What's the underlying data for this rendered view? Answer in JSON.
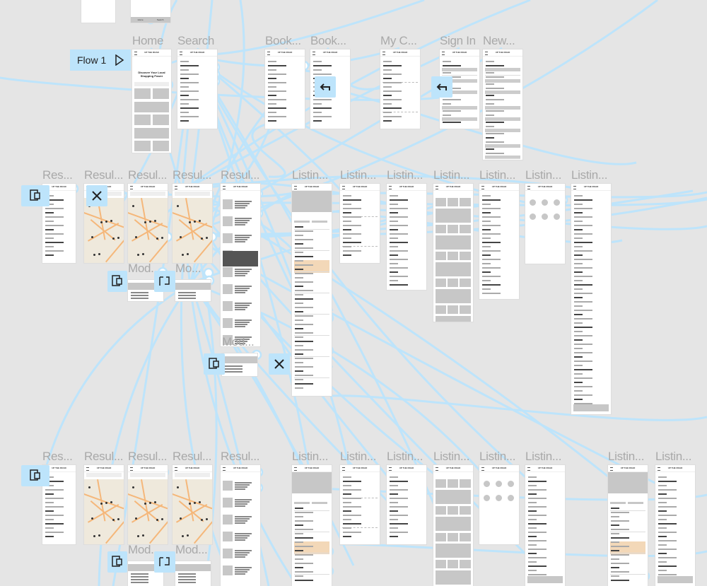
{
  "canvas": {
    "background": "#e5e5e5",
    "wire_color": "#bde4fb"
  },
  "flow": {
    "label": "Flow 1",
    "icon": "play-icon"
  },
  "app_header": "UP THE ROAD",
  "home": {
    "headline": "Discover Your Local Shopping Power",
    "nav": [
      "Home",
      "Search"
    ]
  },
  "frames": {
    "top": [
      "Home",
      "Search",
      "Book...",
      "Book...",
      "My C...",
      "Sign In",
      "New..."
    ],
    "middle": [
      "Res...",
      "Resul...",
      "Resul...",
      "Resul...",
      "Resul...",
      "Listin...",
      "Listin...",
      "Listin...",
      "Listin...",
      "Listin...",
      "Listin...",
      "Listin..."
    ],
    "middle_modals": [
      "Mod...",
      "Mo...",
      "Mod..."
    ],
    "bottom": [
      "Res...",
      "Resul...",
      "Resul...",
      "Resul...",
      "Resul...",
      "Listin...",
      "Listin...",
      "Listin...",
      "Listin...",
      "Listin...",
      "Listin...",
      "Listin...",
      "Listin..."
    ],
    "bottom_modals": [
      "Mod...",
      "Mod..."
    ]
  },
  "overlay_icons": [
    "overlay-icon",
    "close-icon",
    "overlay-icon",
    "swap-overlay-icon",
    "overlay-icon",
    "close-icon",
    "back-icon",
    "back-icon",
    "overlay-icon",
    "overlay-icon",
    "swap-overlay-icon"
  ]
}
